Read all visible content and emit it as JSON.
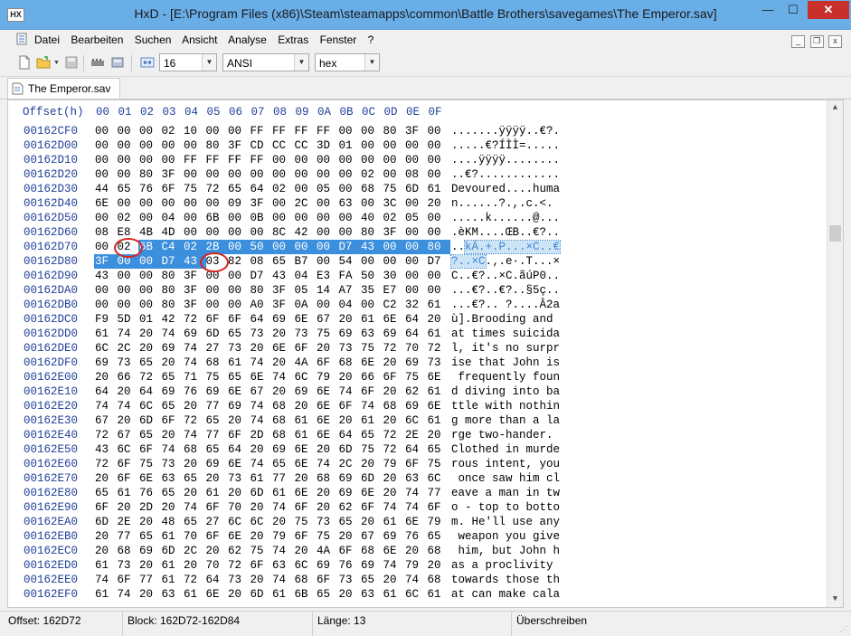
{
  "window": {
    "title": "HxD - [E:\\Program Files (x86)\\Steam\\steamapps\\common\\Battle Brothers\\savegames\\The Emperor.sav]",
    "app_icon_text": "HX",
    "minimize": "—",
    "maximize": "☐",
    "close": "✕"
  },
  "menu": {
    "items": [
      "Datei",
      "Bearbeiten",
      "Suchen",
      "Ansicht",
      "Analyse",
      "Extras",
      "Fenster",
      "?"
    ],
    "mdi_buttons": [
      "_",
      "❐",
      "x"
    ]
  },
  "toolbar": {
    "bytes_per_row": "16",
    "charset": "ANSI",
    "display": "hex"
  },
  "tab": {
    "label": "The Emperor.sav"
  },
  "editor": {
    "offset_header": "Offset(h)",
    "column_headers": [
      "00",
      "01",
      "02",
      "03",
      "04",
      "05",
      "06",
      "07",
      "08",
      "09",
      "0A",
      "0B",
      "0C",
      "0D",
      "0E",
      "0F"
    ],
    "rows": [
      {
        "offset": "00162CF0",
        "bytes": [
          "00",
          "00",
          "00",
          "02",
          "10",
          "00",
          "00",
          "FF",
          "FF",
          "FF",
          "FF",
          "00",
          "00",
          "80",
          "3F",
          "00"
        ],
        "ascii": ".......ÿÿÿÿ..€?."
      },
      {
        "offset": "00162D00",
        "bytes": [
          "00",
          "00",
          "00",
          "00",
          "00",
          "80",
          "3F",
          "CD",
          "CC",
          "CC",
          "3D",
          "01",
          "00",
          "00",
          "00",
          "00"
        ],
        "ascii": ".....€?ÍÌÌ=....."
      },
      {
        "offset": "00162D10",
        "bytes": [
          "00",
          "00",
          "00",
          "00",
          "FF",
          "FF",
          "FF",
          "FF",
          "00",
          "00",
          "00",
          "00",
          "00",
          "00",
          "00",
          "00"
        ],
        "ascii": "....ÿÿÿÿ........"
      },
      {
        "offset": "00162D20",
        "bytes": [
          "00",
          "00",
          "80",
          "3F",
          "00",
          "00",
          "00",
          "00",
          "00",
          "00",
          "00",
          "00",
          "02",
          "00",
          "08",
          "00"
        ],
        "ascii": "..€?............"
      },
      {
        "offset": "00162D30",
        "bytes": [
          "44",
          "65",
          "76",
          "6F",
          "75",
          "72",
          "65",
          "64",
          "02",
          "00",
          "05",
          "00",
          "68",
          "75",
          "6D",
          "61"
        ],
        "ascii": "Devoured....huma"
      },
      {
        "offset": "00162D40",
        "bytes": [
          "6E",
          "00",
          "00",
          "00",
          "00",
          "00",
          "09",
          "3F",
          "00",
          "2C",
          "00",
          "63",
          "00",
          "3C",
          "00",
          "20"
        ],
        "ascii": "n......?.,.c.<. "
      },
      {
        "offset": "00162D50",
        "bytes": [
          "00",
          "02",
          "00",
          "04",
          "00",
          "6B",
          "00",
          "0B",
          "00",
          "00",
          "00",
          "00",
          "40",
          "02",
          "05",
          "00"
        ],
        "ascii": ".....k......@..."
      },
      {
        "offset": "00162D60",
        "bytes": [
          "08",
          "E8",
          "4B",
          "4D",
          "00",
          "00",
          "00",
          "00",
          "8C",
          "42",
          "00",
          "00",
          "80",
          "3F",
          "00",
          "00"
        ],
        "ascii": ".èKM....ŒB..€?.."
      },
      {
        "offset": "00162D70",
        "bytes": [
          "00",
          "02",
          "6B",
          "C4",
          "02",
          "2B",
          "00",
          "50",
          "00",
          "00",
          "00",
          "D7",
          "43",
          "00",
          "00",
          "80"
        ],
        "ascii": "..kÄ.+.P...×C..€"
      },
      {
        "offset": "00162D80",
        "bytes": [
          "3F",
          "00",
          "00",
          "D7",
          "43",
          "03",
          "82",
          "08",
          "65",
          "B7",
          "00",
          "54",
          "00",
          "00",
          "00",
          "D7"
        ],
        "ascii": "?..×C.‚.e·.T...×"
      },
      {
        "offset": "00162D90",
        "bytes": [
          "43",
          "00",
          "00",
          "80",
          "3F",
          "00",
          "00",
          "D7",
          "43",
          "04",
          "E3",
          "FA",
          "50",
          "30",
          "00",
          "00"
        ],
        "ascii": "C..€?..×C.ãúP0.."
      },
      {
        "offset": "00162DA0",
        "bytes": [
          "00",
          "00",
          "00",
          "80",
          "3F",
          "00",
          "00",
          "80",
          "3F",
          "05",
          "14",
          "A7",
          "35",
          "E7",
          "00",
          "00"
        ],
        "ascii": "...€?..€?..§5ç.."
      },
      {
        "offset": "00162DB0",
        "bytes": [
          "00",
          "00",
          "00",
          "80",
          "3F",
          "00",
          "00",
          "A0",
          "3F",
          "0A",
          "00",
          "04",
          "00",
          "C2",
          "32",
          "61"
        ],
        "ascii": "...€?.. ?....Â2a"
      },
      {
        "offset": "00162DC0",
        "bytes": [
          "F9",
          "5D",
          "01",
          "42",
          "72",
          "6F",
          "6F",
          "64",
          "69",
          "6E",
          "67",
          "20",
          "61",
          "6E",
          "64",
          "20"
        ],
        "ascii": "ù].Brooding and "
      },
      {
        "offset": "00162DD0",
        "bytes": [
          "61",
          "74",
          "20",
          "74",
          "69",
          "6D",
          "65",
          "73",
          "20",
          "73",
          "75",
          "69",
          "63",
          "69",
          "64",
          "61"
        ],
        "ascii": "at times suicida"
      },
      {
        "offset": "00162DE0",
        "bytes": [
          "6C",
          "2C",
          "20",
          "69",
          "74",
          "27",
          "73",
          "20",
          "6E",
          "6F",
          "20",
          "73",
          "75",
          "72",
          "70",
          "72"
        ],
        "ascii": "l, it's no surpr"
      },
      {
        "offset": "00162DF0",
        "bytes": [
          "69",
          "73",
          "65",
          "20",
          "74",
          "68",
          "61",
          "74",
          "20",
          "4A",
          "6F",
          "68",
          "6E",
          "20",
          "69",
          "73"
        ],
        "ascii": "ise that John is"
      },
      {
        "offset": "00162E00",
        "bytes": [
          "20",
          "66",
          "72",
          "65",
          "71",
          "75",
          "65",
          "6E",
          "74",
          "6C",
          "79",
          "20",
          "66",
          "6F",
          "75",
          "6E"
        ],
        "ascii": " frequently foun"
      },
      {
        "offset": "00162E10",
        "bytes": [
          "64",
          "20",
          "64",
          "69",
          "76",
          "69",
          "6E",
          "67",
          "20",
          "69",
          "6E",
          "74",
          "6F",
          "20",
          "62",
          "61"
        ],
        "ascii": "d diving into ba"
      },
      {
        "offset": "00162E20",
        "bytes": [
          "74",
          "74",
          "6C",
          "65",
          "20",
          "77",
          "69",
          "74",
          "68",
          "20",
          "6E",
          "6F",
          "74",
          "68",
          "69",
          "6E"
        ],
        "ascii": "ttle with nothin"
      },
      {
        "offset": "00162E30",
        "bytes": [
          "67",
          "20",
          "6D",
          "6F",
          "72",
          "65",
          "20",
          "74",
          "68",
          "61",
          "6E",
          "20",
          "61",
          "20",
          "6C",
          "61"
        ],
        "ascii": "g more than a la"
      },
      {
        "offset": "00162E40",
        "bytes": [
          "72",
          "67",
          "65",
          "20",
          "74",
          "77",
          "6F",
          "2D",
          "68",
          "61",
          "6E",
          "64",
          "65",
          "72",
          "2E",
          "20"
        ],
        "ascii": "rge two-hander. "
      },
      {
        "offset": "00162E50",
        "bytes": [
          "43",
          "6C",
          "6F",
          "74",
          "68",
          "65",
          "64",
          "20",
          "69",
          "6E",
          "20",
          "6D",
          "75",
          "72",
          "64",
          "65"
        ],
        "ascii": "Clothed in murde"
      },
      {
        "offset": "00162E60",
        "bytes": [
          "72",
          "6F",
          "75",
          "73",
          "20",
          "69",
          "6E",
          "74",
          "65",
          "6E",
          "74",
          "2C",
          "20",
          "79",
          "6F",
          "75"
        ],
        "ascii": "rous intent, you"
      },
      {
        "offset": "00162E70",
        "bytes": [
          "20",
          "6F",
          "6E",
          "63",
          "65",
          "20",
          "73",
          "61",
          "77",
          "20",
          "68",
          "69",
          "6D",
          "20",
          "63",
          "6C"
        ],
        "ascii": " once saw him cl"
      },
      {
        "offset": "00162E80",
        "bytes": [
          "65",
          "61",
          "76",
          "65",
          "20",
          "61",
          "20",
          "6D",
          "61",
          "6E",
          "20",
          "69",
          "6E",
          "20",
          "74",
          "77"
        ],
        "ascii": "eave a man in tw"
      },
      {
        "offset": "00162E90",
        "bytes": [
          "6F",
          "20",
          "2D",
          "20",
          "74",
          "6F",
          "70",
          "20",
          "74",
          "6F",
          "20",
          "62",
          "6F",
          "74",
          "74",
          "6F"
        ],
        "ascii": "o - top to botto"
      },
      {
        "offset": "00162EA0",
        "bytes": [
          "6D",
          "2E",
          "20",
          "48",
          "65",
          "27",
          "6C",
          "6C",
          "20",
          "75",
          "73",
          "65",
          "20",
          "61",
          "6E",
          "79"
        ],
        "ascii": "m. He'll use any"
      },
      {
        "offset": "00162EB0",
        "bytes": [
          "20",
          "77",
          "65",
          "61",
          "70",
          "6F",
          "6E",
          "20",
          "79",
          "6F",
          "75",
          "20",
          "67",
          "69",
          "76",
          "65"
        ],
        "ascii": " weapon you give"
      },
      {
        "offset": "00162EC0",
        "bytes": [
          "20",
          "68",
          "69",
          "6D",
          "2C",
          "20",
          "62",
          "75",
          "74",
          "20",
          "4A",
          "6F",
          "68",
          "6E",
          "20",
          "68"
        ],
        "ascii": " him, but John h"
      },
      {
        "offset": "00162ED0",
        "bytes": [
          "61",
          "73",
          "20",
          "61",
          "20",
          "70",
          "72",
          "6F",
          "63",
          "6C",
          "69",
          "76",
          "69",
          "74",
          "79",
          "20"
        ],
        "ascii": "as a proclivity "
      },
      {
        "offset": "00162EE0",
        "bytes": [
          "74",
          "6F",
          "77",
          "61",
          "72",
          "64",
          "73",
          "20",
          "74",
          "68",
          "6F",
          "73",
          "65",
          "20",
          "74",
          "68"
        ],
        "ascii": "towards those th"
      },
      {
        "offset": "00162EF0",
        "bytes": [
          "61",
          "74",
          "20",
          "63",
          "61",
          "6E",
          "20",
          "6D",
          "61",
          "6B",
          "65",
          "20",
          "63",
          "61",
          "6C",
          "61"
        ],
        "ascii": "at can make cala"
      }
    ]
  },
  "status": {
    "offset": "Offset: 162D72",
    "block": "Block: 162D72-162D84",
    "length": "Länge: 13",
    "mode": "Überschreiben"
  },
  "colors": {
    "selection": "#3b8fdc",
    "offset_text": "#1f3f99",
    "annotation_circle": "#d8231d"
  }
}
